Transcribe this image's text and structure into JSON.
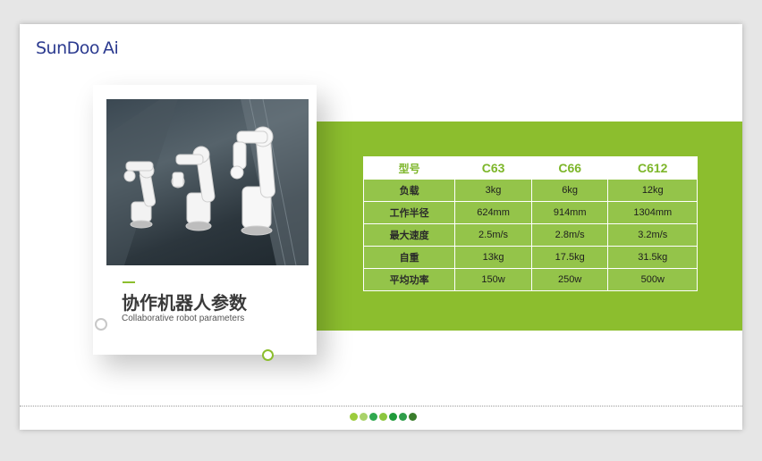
{
  "logo": {
    "brand": "SunDoo",
    "suffix": "Ai"
  },
  "card": {
    "title": "协作机器人参数",
    "subtitle": "Collaborative robot parameters"
  },
  "spec_table": {
    "header": [
      "型号",
      "C63",
      "C66",
      "C612"
    ],
    "rows": [
      [
        "负载",
        "3kg",
        "6kg",
        "12kg"
      ],
      [
        "工作半径",
        "624mm",
        "914mm",
        "1304mm"
      ],
      [
        "最大速度",
        "2.5m/s",
        "2.8m/s",
        "3.2m/s"
      ],
      [
        "自重",
        "13kg",
        "17.5kg",
        "31.5kg"
      ],
      [
        "平均功率",
        "150w",
        "250w",
        "500w"
      ]
    ]
  },
  "pager_dots": [
    "#9ccc3c",
    "#a9d26a",
    "#2fa84f",
    "#8cc63f",
    "#1f9a3a",
    "#2e9d4a",
    "#3a7d2c"
  ],
  "colors": {
    "accent_green": "#8cbe2e",
    "logo_blue": "#2b3a8f"
  }
}
